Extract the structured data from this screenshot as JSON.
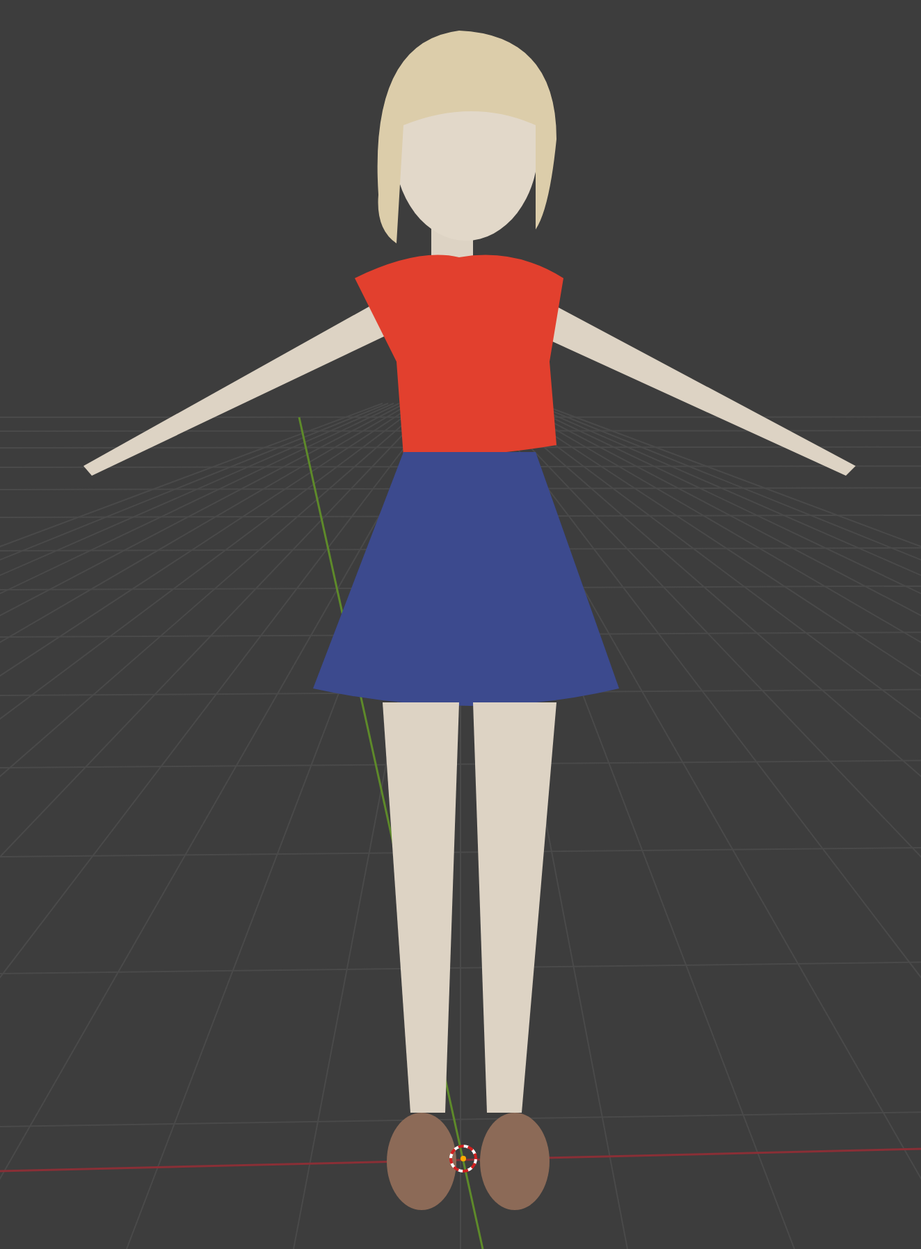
{
  "viewport": {
    "kind": "perspective"
  }
}
